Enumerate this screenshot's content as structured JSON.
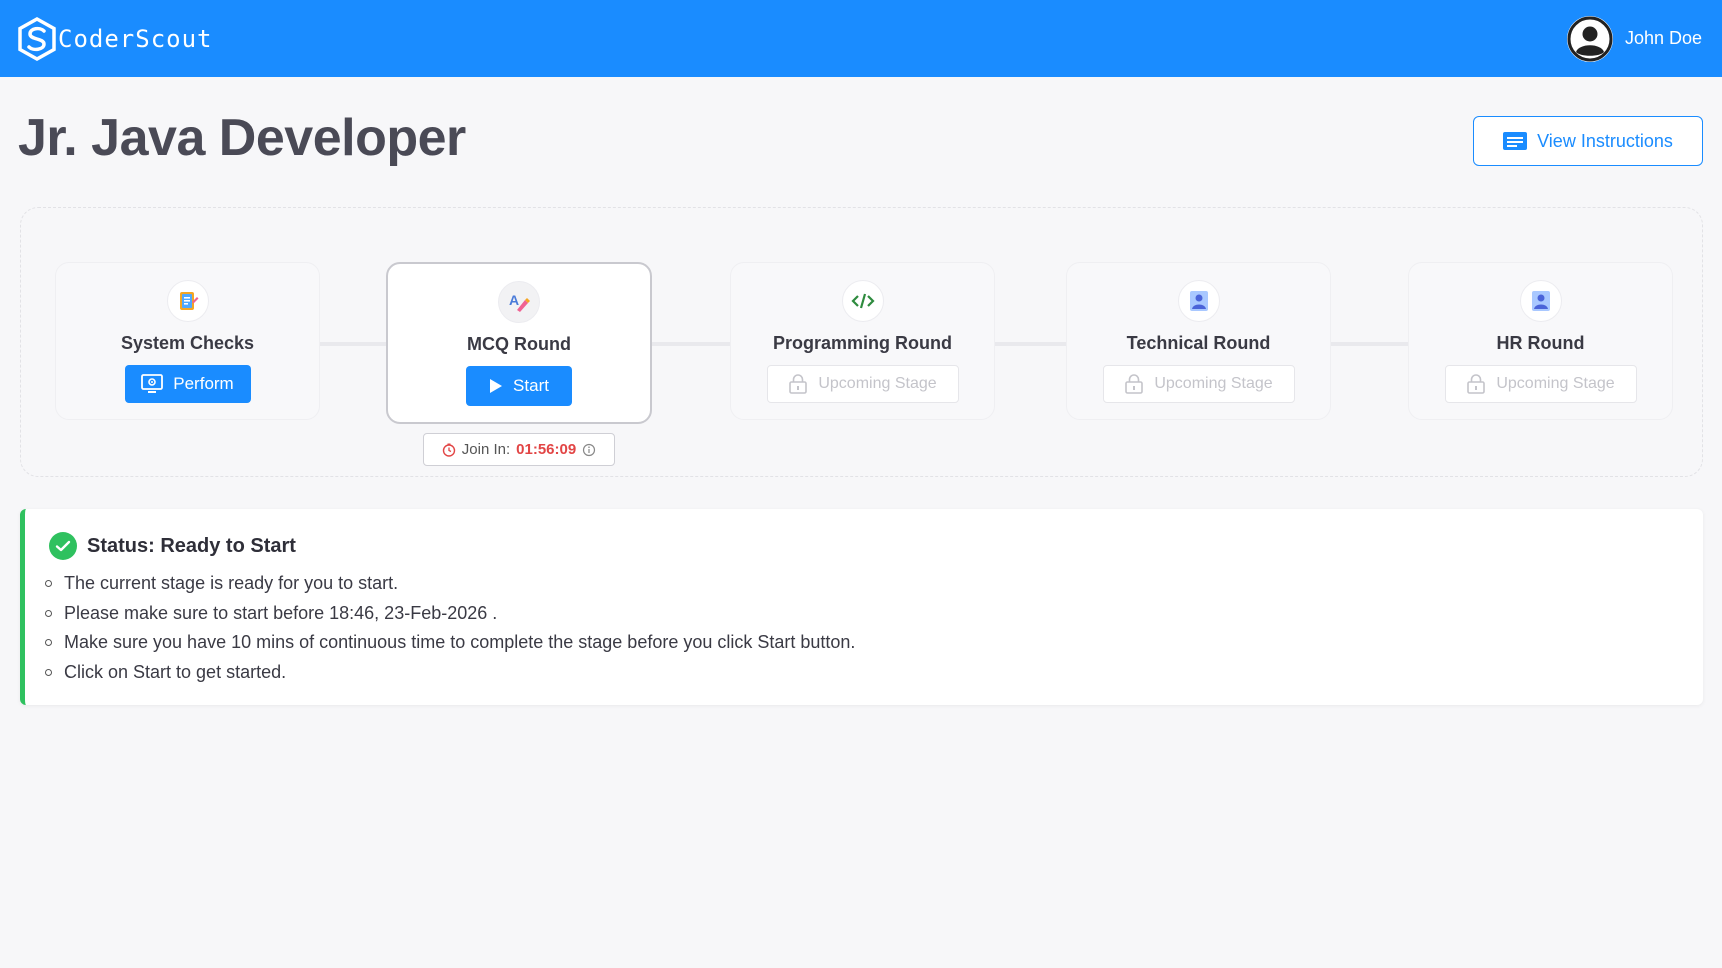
{
  "header": {
    "brand": "CoderScout",
    "user_name": "John Doe",
    "brand_color": "#1a8cff"
  },
  "page": {
    "title": "Jr. Java Developer",
    "view_instructions": "View Instructions"
  },
  "stages": [
    {
      "name": "System Checks",
      "icon": "checklist-icon",
      "action": "Perform",
      "state": "completed-check"
    },
    {
      "name": "MCQ Round",
      "icon": "quiz-icon",
      "action": "Start",
      "state": "active"
    },
    {
      "name": "Programming Round",
      "icon": "code-icon",
      "action": "Upcoming Stage",
      "state": "locked"
    },
    {
      "name": "Technical Round",
      "icon": "interviewer-icon",
      "action": "Upcoming Stage",
      "state": "locked"
    },
    {
      "name": "HR Round",
      "icon": "interviewer-icon",
      "action": "Upcoming Stage",
      "state": "locked"
    }
  ],
  "join": {
    "label": "Join In:",
    "time": "01:56:09"
  },
  "status": {
    "title": "Status: Ready to Start",
    "items": [
      "The current stage is ready for you to start.",
      "Please make sure to start before 18:46, 23-Feb-2026 .",
      "Make sure you have 10 mins of continuous time to complete the stage before you click Start button.",
      "Click on Start to get started."
    ],
    "accent": "#2fc15f"
  }
}
